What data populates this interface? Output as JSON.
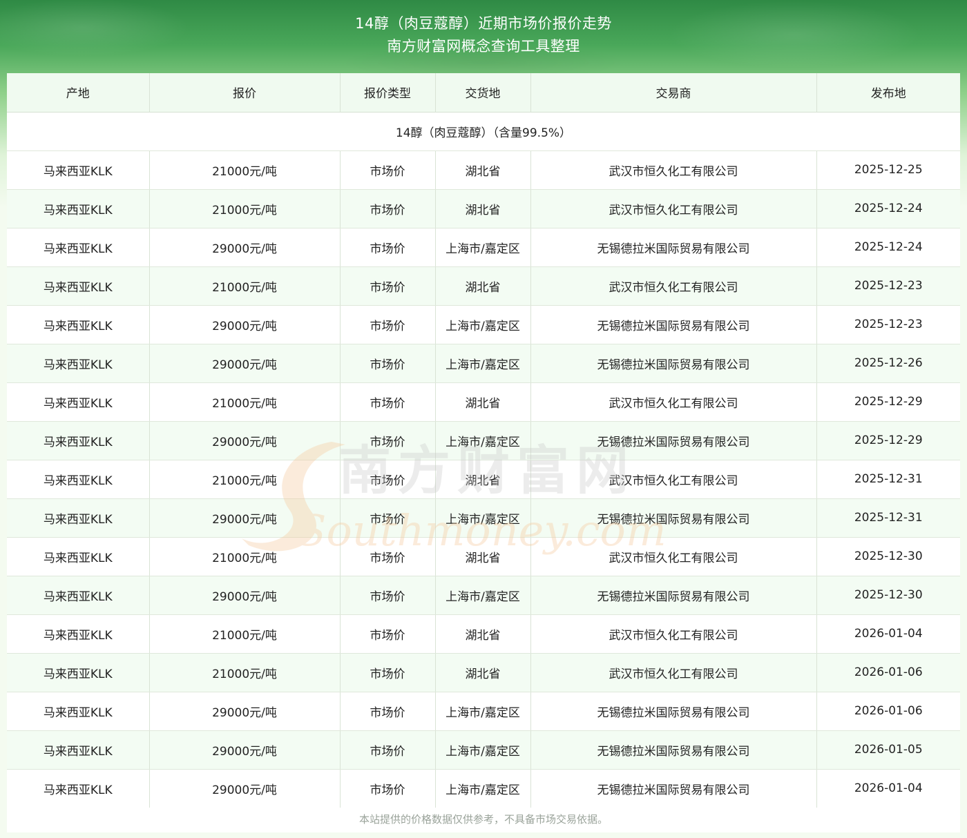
{
  "header": {
    "title": "14醇（肉豆蔻醇）近期市场价报价走势",
    "subtitle": "南方财富网概念查询工具整理"
  },
  "table": {
    "columns": [
      "产地",
      "报价",
      "报价类型",
      "交货地",
      "交易商",
      "发布地"
    ],
    "group_label": "14醇（肉豆蔻醇）（含量99.5%）",
    "rows": [
      [
        "马来西亚KLK",
        "21000元/吨",
        "市场价",
        "湖北省",
        "武汉市恒久化工有限公司",
        "2025-12-25"
      ],
      [
        "马来西亚KLK",
        "21000元/吨",
        "市场价",
        "湖北省",
        "武汉市恒久化工有限公司",
        "2025-12-24"
      ],
      [
        "马来西亚KLK",
        "29000元/吨",
        "市场价",
        "上海市/嘉定区",
        "无锡德拉米国际贸易有限公司",
        "2025-12-24"
      ],
      [
        "马来西亚KLK",
        "21000元/吨",
        "市场价",
        "湖北省",
        "武汉市恒久化工有限公司",
        "2025-12-23"
      ],
      [
        "马来西亚KLK",
        "29000元/吨",
        "市场价",
        "上海市/嘉定区",
        "无锡德拉米国际贸易有限公司",
        "2025-12-23"
      ],
      [
        "马来西亚KLK",
        "29000元/吨",
        "市场价",
        "上海市/嘉定区",
        "无锡德拉米国际贸易有限公司",
        "2025-12-26"
      ],
      [
        "马来西亚KLK",
        "21000元/吨",
        "市场价",
        "湖北省",
        "武汉市恒久化工有限公司",
        "2025-12-29"
      ],
      [
        "马来西亚KLK",
        "29000元/吨",
        "市场价",
        "上海市/嘉定区",
        "无锡德拉米国际贸易有限公司",
        "2025-12-29"
      ],
      [
        "马来西亚KLK",
        "21000元/吨",
        "市场价",
        "湖北省",
        "武汉市恒久化工有限公司",
        "2025-12-31"
      ],
      [
        "马来西亚KLK",
        "29000元/吨",
        "市场价",
        "上海市/嘉定区",
        "无锡德拉米国际贸易有限公司",
        "2025-12-31"
      ],
      [
        "马来西亚KLK",
        "21000元/吨",
        "市场价",
        "湖北省",
        "武汉市恒久化工有限公司",
        "2025-12-30"
      ],
      [
        "马来西亚KLK",
        "29000元/吨",
        "市场价",
        "上海市/嘉定区",
        "无锡德拉米国际贸易有限公司",
        "2025-12-30"
      ],
      [
        "马来西亚KLK",
        "21000元/吨",
        "市场价",
        "湖北省",
        "武汉市恒久化工有限公司",
        "2026-01-04"
      ],
      [
        "马来西亚KLK",
        "21000元/吨",
        "市场价",
        "湖北省",
        "武汉市恒久化工有限公司",
        "2026-01-06"
      ],
      [
        "马来西亚KLK",
        "29000元/吨",
        "市场价",
        "上海市/嘉定区",
        "无锡德拉米国际贸易有限公司",
        "2026-01-06"
      ],
      [
        "马来西亚KLK",
        "29000元/吨",
        "市场价",
        "上海市/嘉定区",
        "无锡德拉米国际贸易有限公司",
        "2026-01-05"
      ],
      [
        "马来西亚KLK",
        "29000元/吨",
        "市场价",
        "上海市/嘉定区",
        "无锡德拉米国际贸易有限公司",
        "2026-01-04"
      ]
    ]
  },
  "watermark": {
    "cn_text": "南方财富网",
    "en_text": "Southmoney.com"
  },
  "footer": {
    "disclaimer": "本站提供的价格数据仅供参考，不具备市场交易依据。"
  },
  "colors": {
    "header_green": "#2f8a45",
    "row_stripe": "#f3fcf3",
    "header_row": "#f0faf0",
    "watermark_orange": "#f6c79a"
  }
}
